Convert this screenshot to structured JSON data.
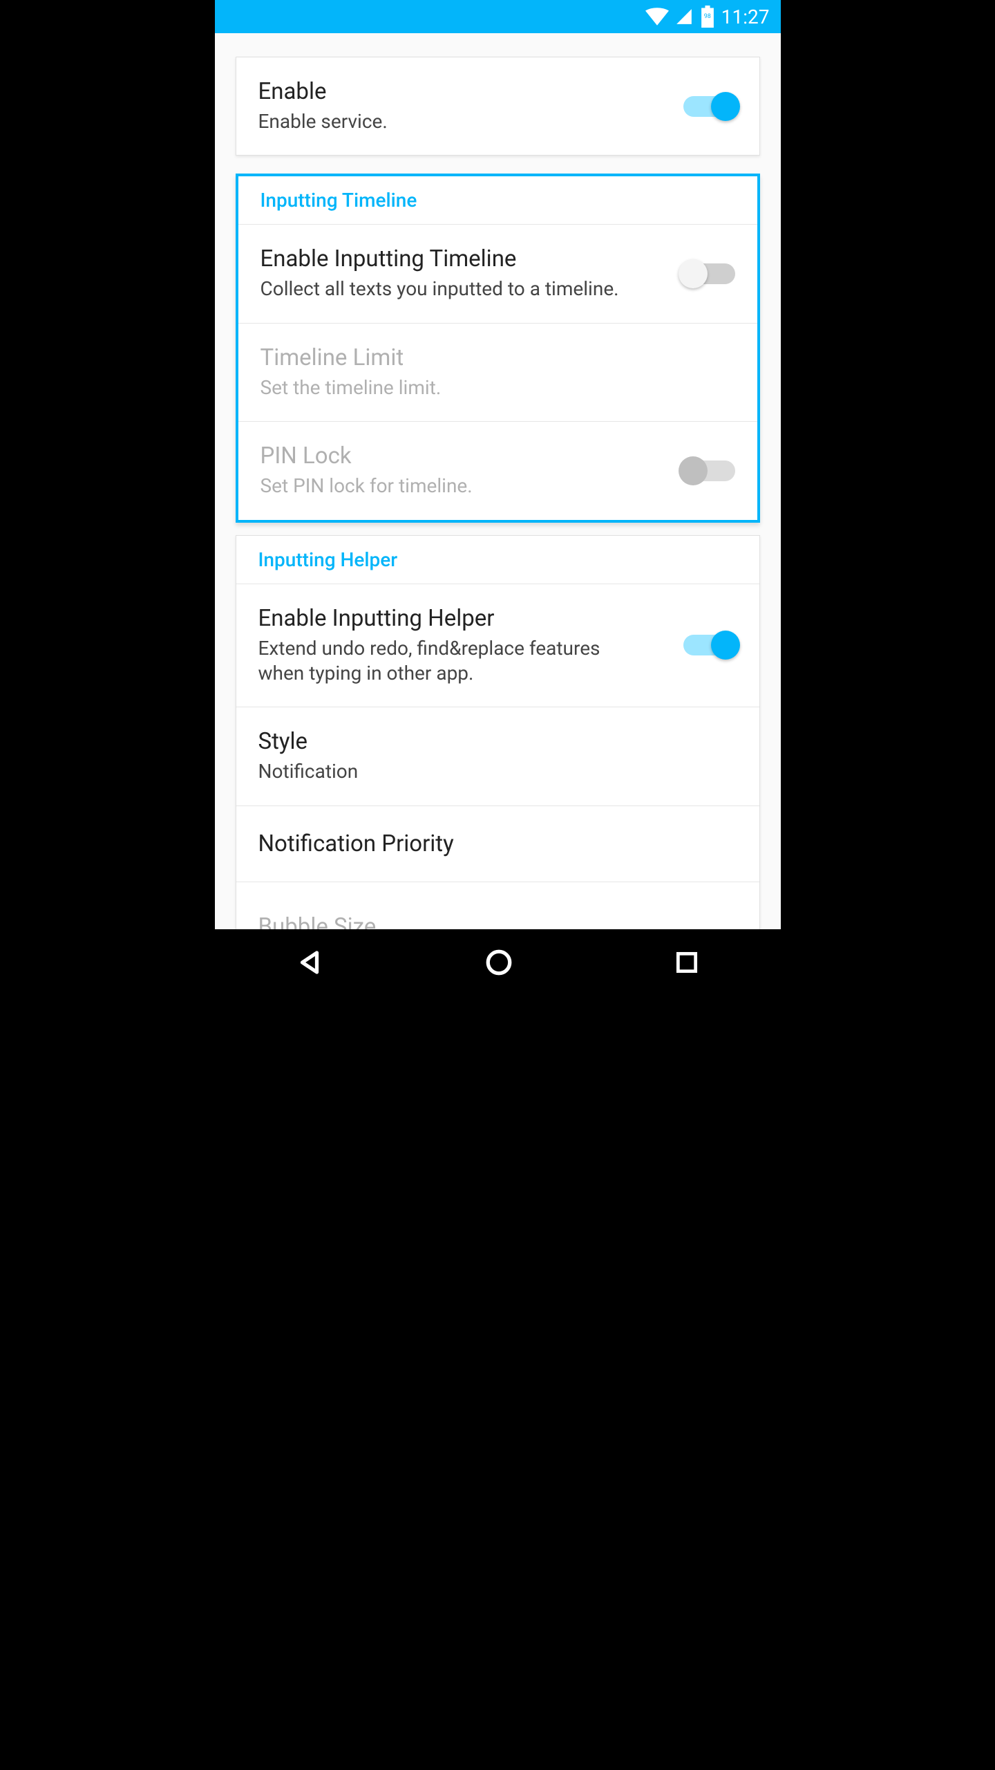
{
  "status": {
    "battery_pct": "98",
    "time": "11:27"
  },
  "settings": {
    "enable": {
      "title": "Enable",
      "sub": "Enable service.",
      "on": true
    },
    "section_timeline": "Inputting Timeline",
    "timeline_enable": {
      "title": "Enable Inputting Timeline",
      "sub": "Collect all texts you inputted to a timeline.",
      "on": false
    },
    "timeline_limit": {
      "title": "Timeline Limit",
      "sub": "Set the timeline limit."
    },
    "pin_lock": {
      "title": "PIN Lock",
      "sub": "Set PIN lock for timeline.",
      "on": false
    },
    "section_helper": "Inputting Helper",
    "helper_enable": {
      "title": "Enable Inputting Helper",
      "sub": "Extend undo redo, find&replace features when typing in other app.",
      "on": true
    },
    "style": {
      "title": "Style",
      "sub": "Notification"
    },
    "notif_priority": {
      "title": "Notification Priority"
    },
    "bubble_size": {
      "title": "Bubble Size"
    }
  }
}
